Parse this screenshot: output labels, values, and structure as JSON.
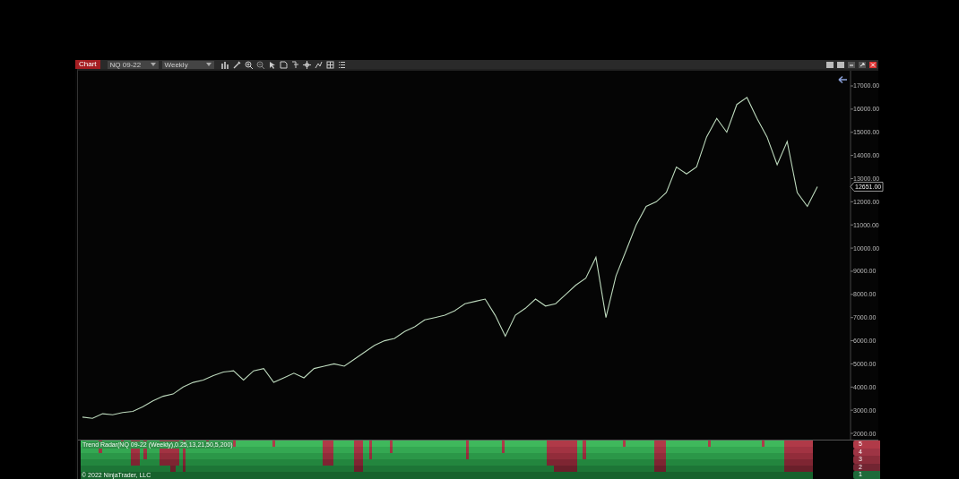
{
  "window": {
    "tab": "Chart",
    "instrument": "NQ 09-22",
    "period": "Weekly"
  },
  "price_chart": {
    "chart_data": {
      "type": "line",
      "ylim": [
        1731,
        17657
      ],
      "yticks": [
        {
          "value": 2000,
          "label": "2000.00"
        },
        {
          "value": 3000,
          "label": "3000.00"
        },
        {
          "value": 4000,
          "label": "4000.00"
        },
        {
          "value": 5000,
          "label": "5000.00"
        },
        {
          "value": 6000,
          "label": "6000.00"
        },
        {
          "value": 7000,
          "label": "7000.00"
        },
        {
          "value": 8000,
          "label": "8000.00"
        },
        {
          "value": 9000,
          "label": "9000.00"
        },
        {
          "value": 10000,
          "label": "10000.00"
        },
        {
          "value": 11000,
          "label": "11000.00"
        },
        {
          "value": 12000,
          "label": "12000.00"
        },
        {
          "value": 13000,
          "label": "13000.00"
        },
        {
          "value": 14000,
          "label": "14000.00"
        },
        {
          "value": 15000,
          "label": "15000.00"
        },
        {
          "value": 16000,
          "label": "16000.00"
        },
        {
          "value": 17000,
          "label": "17000.00"
        }
      ],
      "categories": [
        null,
        null,
        null,
        null,
        null,
        null,
        null,
        null,
        null,
        null,
        null,
        null,
        null,
        null,
        null,
        null,
        null,
        null,
        null,
        null,
        null,
        null,
        null,
        null,
        null,
        null,
        null,
        null,
        null,
        null,
        null,
        null,
        null,
        null,
        null,
        null,
        null,
        null,
        null,
        null,
        null,
        null,
        null,
        null,
        null,
        null,
        null,
        null,
        null,
        null,
        null,
        null,
        null,
        null,
        null,
        null,
        null,
        null,
        null,
        null,
        null,
        null,
        null,
        null,
        null,
        null,
        null,
        null,
        null,
        null,
        null,
        null,
        null,
        null
      ],
      "series": [
        {
          "color": "#bcd8bc",
          "values": [
            2700,
            2650,
            2850,
            2800,
            2900,
            2950,
            3150,
            3400,
            3600,
            3700,
            4000,
            4200,
            4300,
            4500,
            4650,
            4700,
            4300,
            4700,
            4800,
            4200,
            4400,
            4600,
            4400,
            4800,
            4900,
            5000,
            4900,
            5200,
            5500,
            5800,
            6000,
            6100,
            6400,
            6600,
            6900,
            7000,
            7100,
            7300,
            7600,
            7700,
            7800,
            7100,
            6200,
            7100,
            7400,
            7800,
            7500,
            7600,
            8000,
            8400,
            8700,
            9600,
            7000,
            8800,
            9900,
            11000,
            11800,
            12000,
            12400,
            13500,
            13200,
            13500,
            14800,
            15600,
            15000,
            16200,
            16500,
            15600,
            14800,
            13600,
            14600,
            12400,
            11800,
            12650
          ]
        }
      ]
    },
    "last_price": "12651.00"
  },
  "indicator": {
    "title": "Trend Radar(NQ 09-22 (Weekly),0.25,13,21,50,5,200)",
    "copyright": "© 2022 NinjaTrader, LLC",
    "levels": [
      {
        "label": "5",
        "color": "#b03a48"
      },
      {
        "label": "4",
        "color": "#9e3444"
      },
      {
        "label": "3",
        "color": "#8a2c3a"
      },
      {
        "label": "2",
        "color": "#722532"
      },
      {
        "label": "1",
        "color": "#1e6a3a"
      }
    ]
  }
}
